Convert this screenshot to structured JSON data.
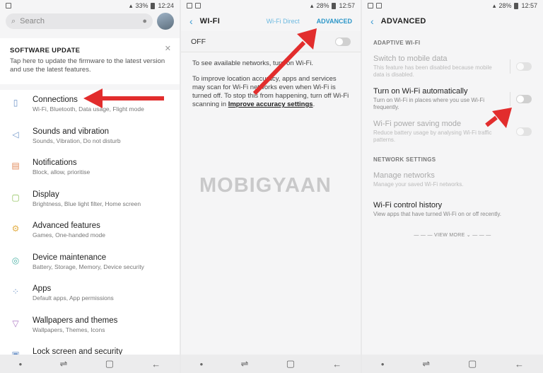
{
  "colors": {
    "accent": "#2b96c8",
    "arrow": "#e22d2d"
  },
  "watermark": "MOBIGYAAN",
  "panel1": {
    "status": {
      "battery": "33%",
      "time": "12:24"
    },
    "search": {
      "placeholder": "Search"
    },
    "update": {
      "title": "SOFTWARE UPDATE",
      "text": "Tap here to update the firmware to the latest version and use the latest features."
    },
    "items": [
      {
        "icon": "connections-icon",
        "title": "Connections",
        "sub": "Wi-Fi, Bluetooth, Data usage, Flight mode"
      },
      {
        "icon": "sound-icon",
        "title": "Sounds and vibration",
        "sub": "Sounds, Vibration, Do not disturb"
      },
      {
        "icon": "notifications-icon",
        "title": "Notifications",
        "sub": "Block, allow, prioritise"
      },
      {
        "icon": "display-icon",
        "title": "Display",
        "sub": "Brightness, Blue light filter, Home screen"
      },
      {
        "icon": "advanced-features-icon",
        "title": "Advanced features",
        "sub": "Games, One-handed mode"
      },
      {
        "icon": "device-maintenance-icon",
        "title": "Device maintenance",
        "sub": "Battery, Storage, Memory, Device security"
      },
      {
        "icon": "apps-icon",
        "title": "Apps",
        "sub": "Default apps, App permissions"
      },
      {
        "icon": "wallpapers-icon",
        "title": "Wallpapers and themes",
        "sub": "Wallpapers, Themes, Icons"
      },
      {
        "icon": "lock-icon",
        "title": "Lock screen and security",
        "sub": ""
      }
    ]
  },
  "panel2": {
    "status": {
      "battery": "28%",
      "time": "12:57"
    },
    "title": "WI-FI",
    "wifi_direct": "Wi-Fi Direct",
    "advanced": "ADVANCED",
    "off_label": "OFF",
    "text1": "To see available networks, turn on Wi-Fi.",
    "text2": "To improve location accuracy, apps and services may scan for Wi-Fi networks even when Wi-Fi is turned off. To stop this from happening, turn off Wi-Fi scanning in",
    "link": "Improve accuracy settings",
    "period": "."
  },
  "panel3": {
    "status": {
      "battery": "28%",
      "time": "12:57"
    },
    "title": "ADVANCED",
    "section1": "ADAPTIVE WI-FI",
    "items1": [
      {
        "title": "Switch to mobile data",
        "sub": "This feature has been disabled because mobile data is disabled.",
        "disabled": true
      },
      {
        "title": "Turn on Wi-Fi automatically",
        "sub": "Turn on Wi-Fi in places where you use Wi-Fi frequently.",
        "disabled": false
      },
      {
        "title": "Wi-Fi power saving mode",
        "sub": "Reduce battery usage by analysing Wi-Fi traffic patterns.",
        "disabled": true
      }
    ],
    "section2": "NETWORK SETTINGS",
    "manage": {
      "title": "Manage networks",
      "sub": "Manage your saved Wi-Fi networks."
    },
    "history": {
      "title": "Wi-Fi control history",
      "sub": "View apps that have turned Wi-Fi on or off recently."
    },
    "view_more": "VIEW MORE"
  }
}
